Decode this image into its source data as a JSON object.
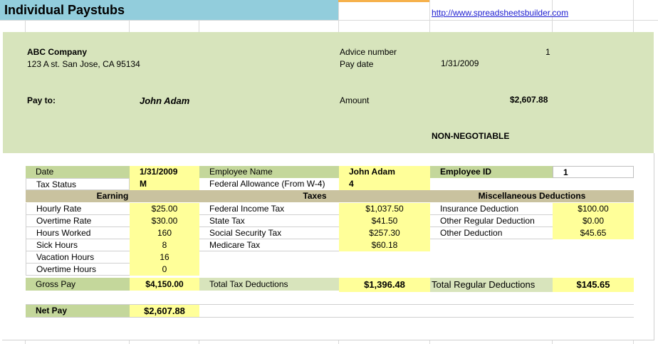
{
  "title": "Individual Paystubs",
  "link": "http://www.spreadsheetsbuilder.com",
  "company": {
    "name": "ABC Company",
    "address": "123 A st. San Jose, CA 95134"
  },
  "advice": {
    "label": "Advice number",
    "value": "1"
  },
  "paydate": {
    "label": "Pay date",
    "value": "1/31/2009"
  },
  "payto": {
    "label": "Pay to:",
    "value": "John Adam"
  },
  "amount": {
    "label": "Amount",
    "value": "$2,607.88"
  },
  "nonneg": "NON-NEGOTIABLE",
  "info": {
    "date_label": "Date",
    "date_value": "1/31/2009",
    "emp_name_label": "Employee Name",
    "emp_name_value": "John Adam",
    "emp_id_label": "Employee ID",
    "emp_id_value": "1",
    "tax_status_label": "Tax Status",
    "tax_status_value": "M",
    "fed_allow_label": "Federal Allowance (From W-4)",
    "fed_allow_value": "4"
  },
  "sections": {
    "earning": "Earning",
    "taxes": "Taxes",
    "misc": "Miscellaneous Deductions"
  },
  "earning": [
    {
      "label": "Hourly Rate",
      "value": "$25.00"
    },
    {
      "label": "Overtime Rate",
      "value": "$30.00"
    },
    {
      "label": "Hours Worked",
      "value": "160"
    },
    {
      "label": "Sick Hours",
      "value": "8"
    },
    {
      "label": "Vacation Hours",
      "value": "16"
    },
    {
      "label": "Overtime Hours",
      "value": "0"
    }
  ],
  "taxes": [
    {
      "label": "Federal Income Tax",
      "value": "$1,037.50"
    },
    {
      "label": "State Tax",
      "value": "$41.50"
    },
    {
      "label": "Social Security Tax",
      "value": "$257.30"
    },
    {
      "label": "Medicare Tax",
      "value": "$60.18"
    }
  ],
  "misc": [
    {
      "label": "Insurance Deduction",
      "value": "$100.00"
    },
    {
      "label": "Other Regular Deduction",
      "value": "$0.00"
    },
    {
      "label": "Other Deduction",
      "value": "$45.65"
    }
  ],
  "totals": {
    "gross_label": "Gross Pay",
    "gross_value": "$4,150.00",
    "tax_label": "Total Tax Deductions",
    "tax_value": "$1,396.48",
    "reg_label": "Total Regular Deductions",
    "reg_value": "$145.65",
    "net_label": "Net Pay",
    "net_value": "$2,607.88"
  }
}
